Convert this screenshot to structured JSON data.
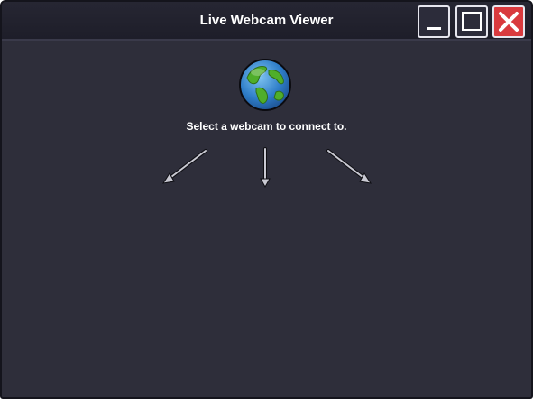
{
  "window": {
    "title": "Live Webcam Viewer",
    "controls": [
      "minimize",
      "maximize",
      "close"
    ]
  },
  "main": {
    "icon": "globe-icon",
    "prompt": "Select a webcam to connect to.",
    "arrows": [
      "arrow-down-left",
      "arrow-down",
      "arrow-down-right"
    ]
  },
  "colors": {
    "window_bg": "#2e2e3a",
    "titlebar_bg": "#1e1e29",
    "close_button": "#d93a3e",
    "text": "#ffffff"
  }
}
